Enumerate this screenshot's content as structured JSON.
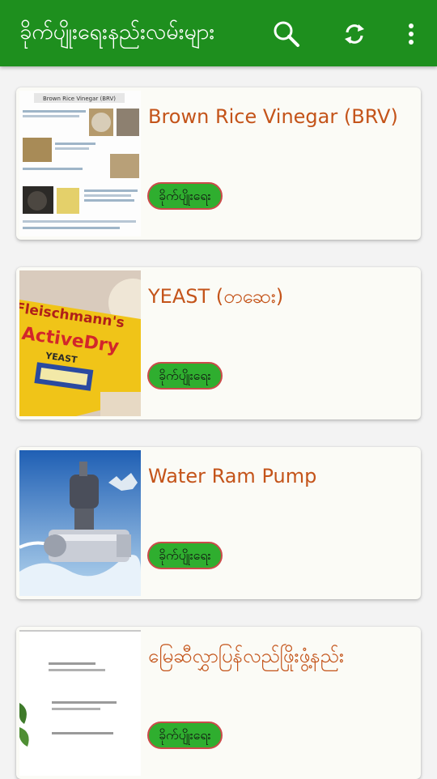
{
  "app": {
    "title": "ခိုက်ပျိုးရေးနည်းလမ်းများ",
    "theme_color": "#1e8f1e",
    "actions": [
      {
        "icon": "search-icon"
      },
      {
        "icon": "refresh-icon"
      },
      {
        "icon": "more-vert-icon"
      }
    ]
  },
  "articles": [
    {
      "title": "Brown Rice Vinegar (BRV)",
      "category": "ခိုက်ပျိုးရေး",
      "thumbnail": "document-infographic",
      "thumbnail_caption": "Brown Rice Vinegar (BRV)"
    },
    {
      "title": "YEAST (တဆေး)",
      "category": "ခိုက်ပျိုးရေး",
      "thumbnail": "yeast-package",
      "thumbnail_text": [
        "Fleischmann's",
        "ActiveDry",
        "YEAST"
      ]
    },
    {
      "title": "Water Ram Pump",
      "category": "ခိုက်ပျိုးရေး",
      "thumbnail": "ram-pump-photo"
    },
    {
      "title": "မြေဆီလွှာပြန်လည်ဖြိုးဖွံ့နည်း",
      "category": "ခိုက်ပျိုးရေး",
      "thumbnail": "document-page"
    }
  ],
  "colors": {
    "title_text": "#c4541a",
    "badge_fill": "#2fae2f",
    "badge_border": "#cc4a4a",
    "card_bg": "#fbfbf6"
  }
}
